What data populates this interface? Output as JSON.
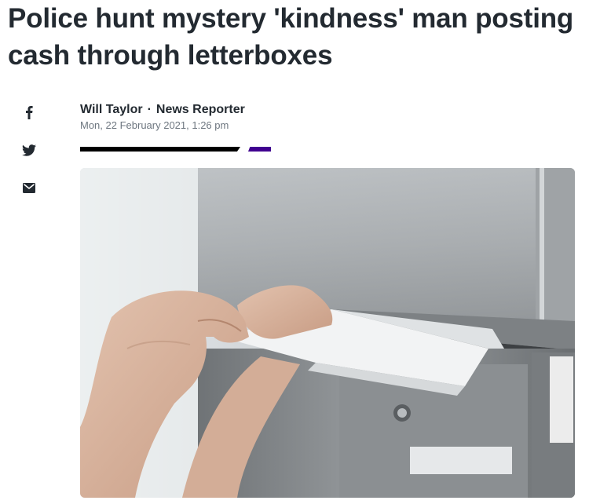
{
  "article": {
    "headline": "Police hunt mystery 'kindness' man posting cash through letterboxes",
    "author": "Will Taylor",
    "separator": "·",
    "role": "News Reporter",
    "date": "Mon, 22 February 2021, 1:26 pm"
  },
  "share": {
    "icons": [
      "facebook-icon",
      "twitter-icon",
      "email-icon"
    ]
  },
  "photo": {
    "subject": "hands posting envelope into stainless steel mailbox"
  },
  "colors": {
    "text": "#232a31",
    "muted": "#6e7780",
    "accent_purple": "#400090",
    "bar_black": "#000000"
  }
}
